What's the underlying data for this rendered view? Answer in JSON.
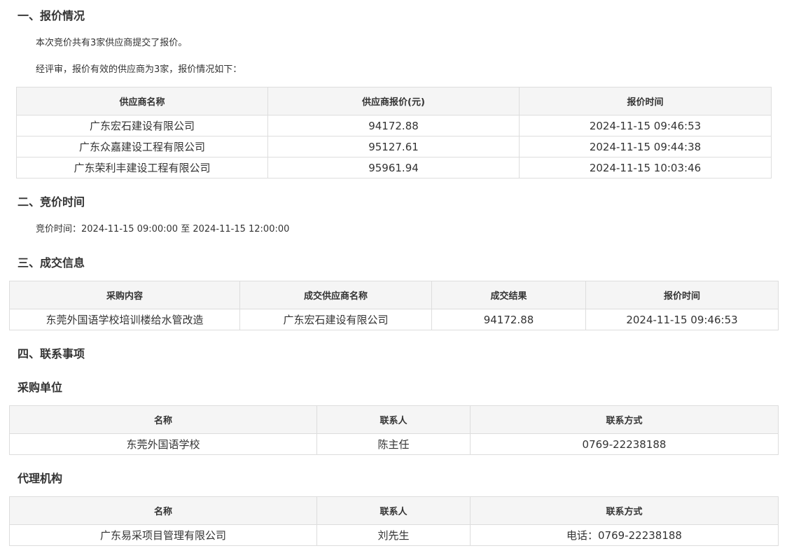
{
  "sections": {
    "s1": {
      "title": "一、报价情况",
      "p1": "本次竞价共有3家供应商提交了报价。",
      "p2": "经评审，报价有效的供应商为3家，报价情况如下："
    },
    "s2": {
      "title": "二、竞价时间",
      "p1": "竞价时间：2024-11-15 09:00:00 至 2024-11-15 12:00:00"
    },
    "s3": {
      "title": "三、成交信息"
    },
    "s4": {
      "title": "四、联系事项",
      "buyer_title": "采购单位",
      "agency_title": "代理机构"
    }
  },
  "quote_table": {
    "headers": [
      "供应商名称",
      "供应商报价(元)",
      "报价时间"
    ],
    "rows": [
      [
        "广东宏石建设有限公司",
        "94172.88",
        "2024-11-15 09:46:53"
      ],
      [
        "广东众嘉建设工程有限公司",
        "95127.61",
        "2024-11-15 09:44:38"
      ],
      [
        "广东荣利丰建设工程有限公司",
        "95961.94",
        "2024-11-15 10:03:46"
      ]
    ]
  },
  "deal_table": {
    "headers": [
      "采购内容",
      "成交供应商名称",
      "成交结果",
      "报价时间"
    ],
    "rows": [
      [
        "东莞外国语学校培训楼给水管改造",
        "广东宏石建设有限公司",
        "94172.88",
        "2024-11-15 09:46:53"
      ]
    ]
  },
  "buyer_table": {
    "headers": [
      "名称",
      "联系人",
      "联系方式"
    ],
    "rows": [
      [
        "东莞外国语学校",
        "陈主任",
        "0769-22238188"
      ]
    ]
  },
  "agency_table": {
    "headers": [
      "名称",
      "联系人",
      "联系方式"
    ],
    "rows": [
      [
        "广东易采项目管理有限公司",
        "刘先生",
        "电话：0769-22238188"
      ]
    ]
  }
}
